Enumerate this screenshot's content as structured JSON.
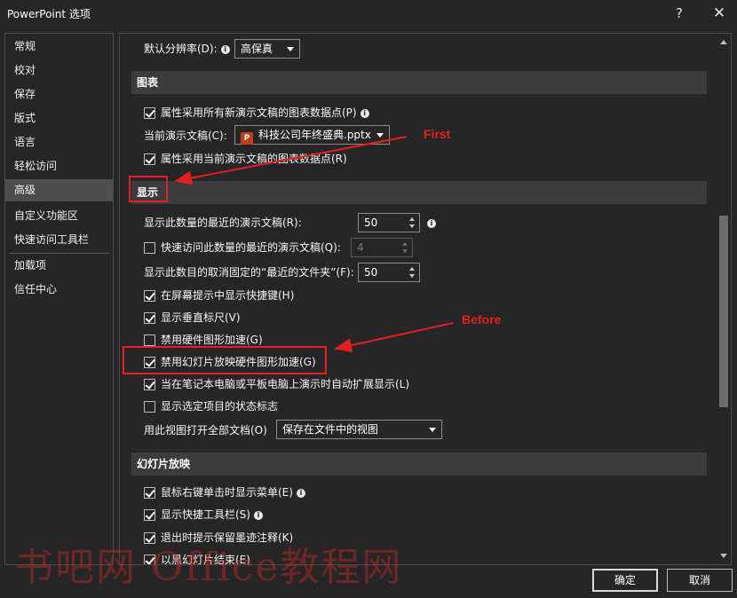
{
  "window": {
    "title": "PowerPoint 选项",
    "help": "?",
    "close": "✕"
  },
  "sidebar": {
    "items": [
      {
        "label": "常规"
      },
      {
        "label": "校对"
      },
      {
        "label": "保存"
      },
      {
        "label": "版式"
      },
      {
        "label": "语言"
      },
      {
        "label": "轻松访问"
      },
      {
        "label": "高级",
        "active": true
      },
      {
        "label": "自定义功能区"
      },
      {
        "label": "快速访问工具栏"
      },
      {
        "label": "加载项"
      },
      {
        "label": "信任中心"
      }
    ]
  },
  "content": {
    "resolution": {
      "label": "默认分辨率(D):",
      "value": "高保真"
    },
    "chart_section": {
      "title": "图表",
      "opt1": "属性采用所有新演示文稿的图表数据点(P)",
      "doc_label": "当前演示文稿(C):",
      "doc_value": "科技公司年终盛典.pptx",
      "opt2": "属性采用当前演示文稿的图表数据点(R)"
    },
    "display_section": {
      "title": "显示",
      "recent_docs_label": "显示此数量的最近的演示文稿(R):",
      "recent_docs_value": "50",
      "quick_access_label": "快速访问此数量的最近的演示文稿(Q):",
      "quick_access_value": "4",
      "unpinned_label": "显示此数目的取消固定的“最近的文件夹”(F):",
      "unpinned_value": "50",
      "opt_shortcuts": "在屏幕提示中显示快捷键(H)",
      "opt_ruler": "显示垂直标尺(V)",
      "opt_hw_accel": "禁用硬件图形加速(G)",
      "opt_slideshow_accel": "禁用幻灯片放映硬件图形加速(G)",
      "opt_autoextend": "当在笔记本电脑或平板电脑上演示时自动扩展显示(L)",
      "opt_status": "显示选定项目的状态标志",
      "view_label": "用此视图打开全部文档(O)",
      "view_value": "保存在文件中的视图"
    },
    "slideshow_section": {
      "title": "幻灯片放映",
      "opt_rightclick": "鼠标右键单击时显示菜单(E)",
      "opt_toolbar": "显示快捷工具栏(S)",
      "opt_ink": "退出时提示保留墨迹注释(K)",
      "opt_black": "以黑幻灯片结束(E)"
    }
  },
  "buttons": {
    "ok": "确定",
    "cancel": "取消"
  },
  "annotations": {
    "first": "First",
    "before": "Before",
    "color": "#e52020"
  },
  "watermark": "书吧网 Office教程网"
}
